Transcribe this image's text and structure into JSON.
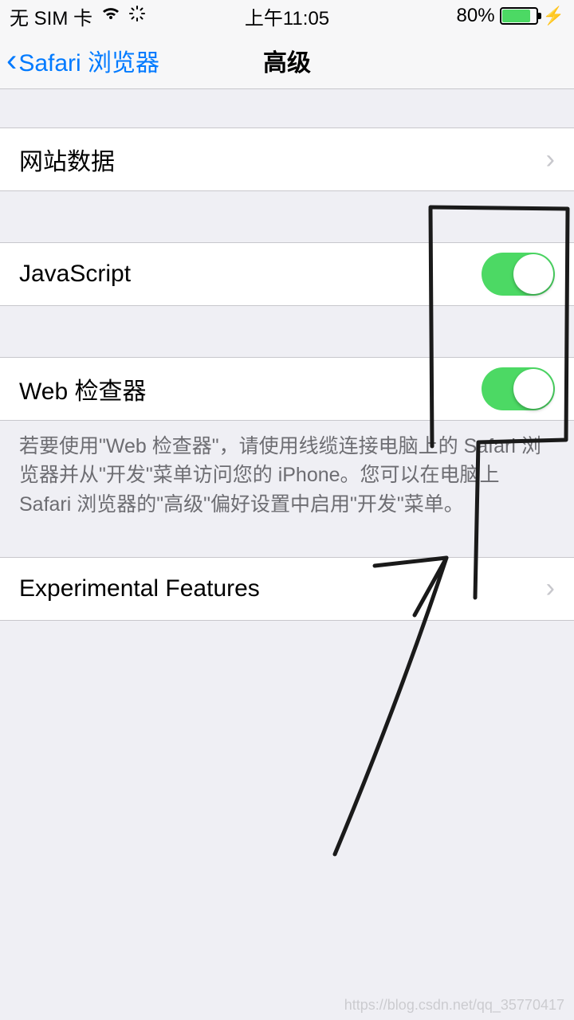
{
  "status": {
    "carrier": "无 SIM 卡",
    "time": "上午11:05",
    "battery_text": "80%"
  },
  "nav": {
    "back_label": "Safari 浏览器",
    "title": "高级"
  },
  "rows": {
    "website_data": "网站数据",
    "javascript": "JavaScript",
    "web_inspector": "Web 检查器",
    "experimental": "Experimental Features"
  },
  "footer": {
    "web_inspector_help": "若要使用\"Web 检查器\"，请使用线缆连接电脑上的 Safari 浏览器并从\"开发\"菜单访问您的 iPhone。您可以在电脑上 Safari 浏览器的\"高级\"偏好设置中启用\"开发\"菜单。"
  },
  "toggles": {
    "javascript_on": true,
    "web_inspector_on": true
  },
  "watermark": "https://blog.csdn.net/qq_35770417"
}
